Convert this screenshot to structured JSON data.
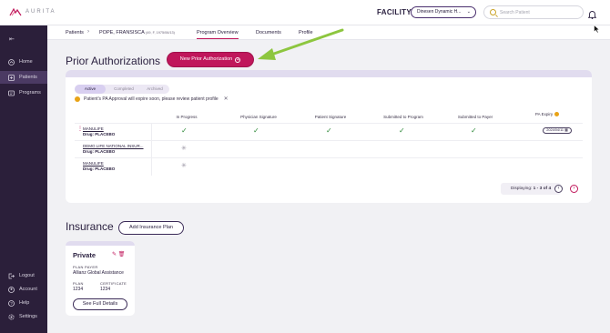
{
  "app": {
    "logo_text": "AURITA"
  },
  "topbar": {
    "facility_label": "FACILITY",
    "facility_value": "Dinesen Dynamic H...",
    "search_placeholder": "Search Patient"
  },
  "sidebar": {
    "items": [
      {
        "label": "Home",
        "icon": "home-icon"
      },
      {
        "label": "Patients",
        "icon": "patients-icon",
        "active": true
      },
      {
        "label": "Programs",
        "icon": "programs-icon"
      },
      {
        "label": "Logout",
        "icon": "logout-icon"
      },
      {
        "label": "Account",
        "icon": "account-icon"
      },
      {
        "label": "Help",
        "icon": "help-icon"
      },
      {
        "label": "Settings",
        "icon": "settings-icon"
      }
    ]
  },
  "breadcrumb": {
    "root": "Patients",
    "patient_name": "POPE, FRANSISCA",
    "patient_meta": "(49, F, 1975/06/13)"
  },
  "tabs": [
    "Program Overview",
    "Documents",
    "Profile"
  ],
  "prior_auth": {
    "title": "Prior Authorizations",
    "new_button": "New Prior Authorization",
    "filters": [
      "Active",
      "Completed",
      "Archived"
    ],
    "alert": "Patient's PA Approval will expire soon, please review patient profile",
    "columns": [
      "In Progress",
      "Physician Signature",
      "Patient Signature",
      "Submitted to Program",
      "Submitted to Payer",
      "PA Expiry"
    ],
    "rows": [
      {
        "payer": "MANULIFE",
        "drug": "Drug: PLACEBO",
        "status": "done",
        "expiry": "2024/04/11"
      },
      {
        "payer": "DEMO LIFE NATIONAL INSUR...",
        "drug": "Drug: PLACEBO",
        "status": "pending",
        "expiry": ""
      },
      {
        "payer": "MANULIFE",
        "drug": "Drug: PLACEBO",
        "status": "pending",
        "expiry": ""
      }
    ],
    "pager": {
      "prefix": "Displaying:",
      "range": "1 - 3 of 4"
    }
  },
  "insurance": {
    "title": "Insurance",
    "add_button": "Add Insurance Plan",
    "card": {
      "type": "Private",
      "payer_label": "PLAN PAYER",
      "payer": "Allianz Global Assistance",
      "plan_label": "PLAN",
      "plan": "1234",
      "cert_label": "CERTIFICATE",
      "cert": "1234",
      "details_button": "See Full Details"
    }
  },
  "colors": {
    "accent": "#c0175b",
    "sidebar": "#2b1f3a",
    "check": "#2f8a3a",
    "warning": "#e8a317",
    "arrow": "#8dc63f"
  }
}
